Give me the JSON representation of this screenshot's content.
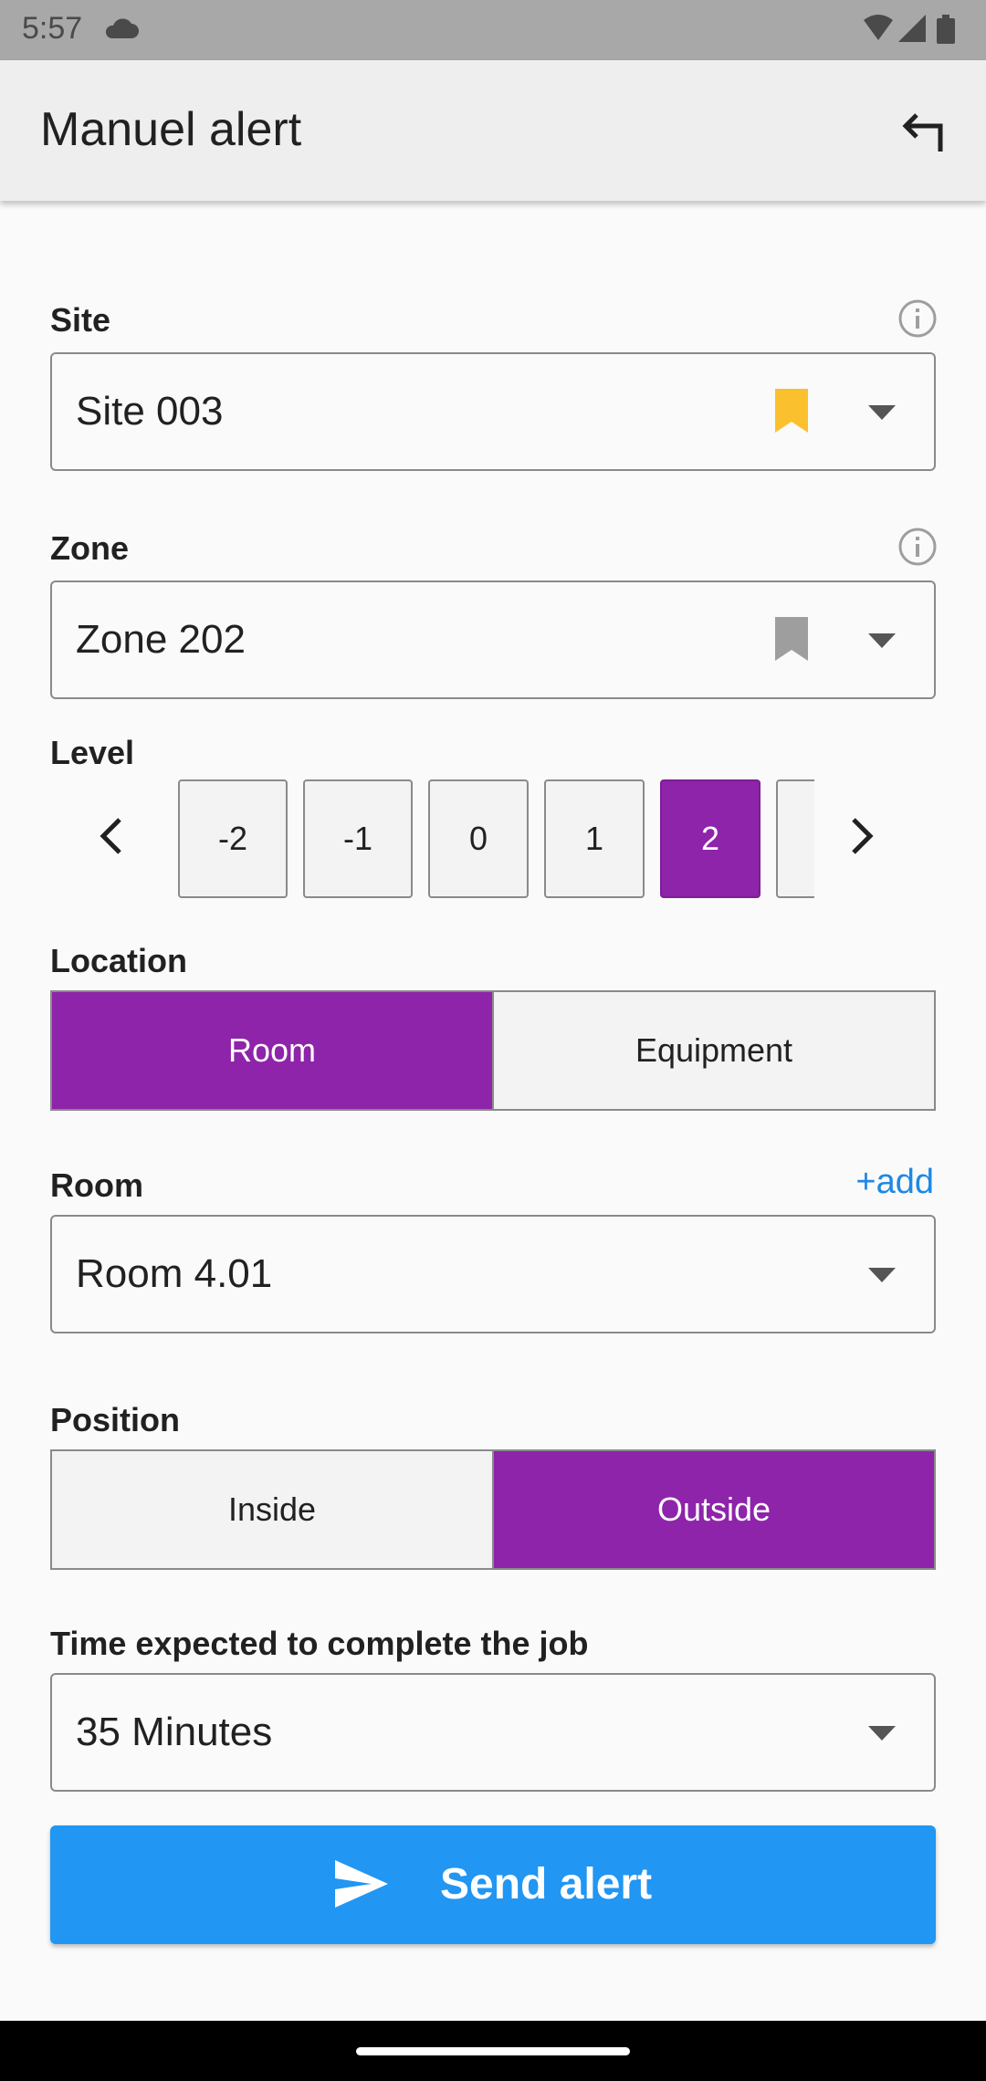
{
  "status_bar": {
    "time": "5:57"
  },
  "app_bar": {
    "title": "Manuel alert"
  },
  "site": {
    "label": "Site",
    "value": "Site 003"
  },
  "zone": {
    "label": "Zone",
    "value": "Zone 202"
  },
  "level": {
    "label": "Level",
    "options": [
      "-2",
      "-1",
      "0",
      "1",
      "2"
    ],
    "selected": "2"
  },
  "location": {
    "label": "Location",
    "options": [
      "Room",
      "Equipment"
    ],
    "selected": "Room"
  },
  "room": {
    "label": "Room",
    "add_label": "+add",
    "value": "Room 4.01"
  },
  "position": {
    "label": "Position",
    "options": [
      "Inside",
      "Outside"
    ],
    "selected": "Outside"
  },
  "time_expected": {
    "label": "Time expected to complete the job",
    "value": "35 Minutes"
  },
  "send_button": {
    "label": "Send alert"
  },
  "colors": {
    "accent_purple": "#8e24aa",
    "primary_blue": "#2196f3",
    "bookmark_active": "#fbc02d",
    "bookmark_inactive": "#9e9e9e",
    "link_blue": "#1e88e5"
  }
}
